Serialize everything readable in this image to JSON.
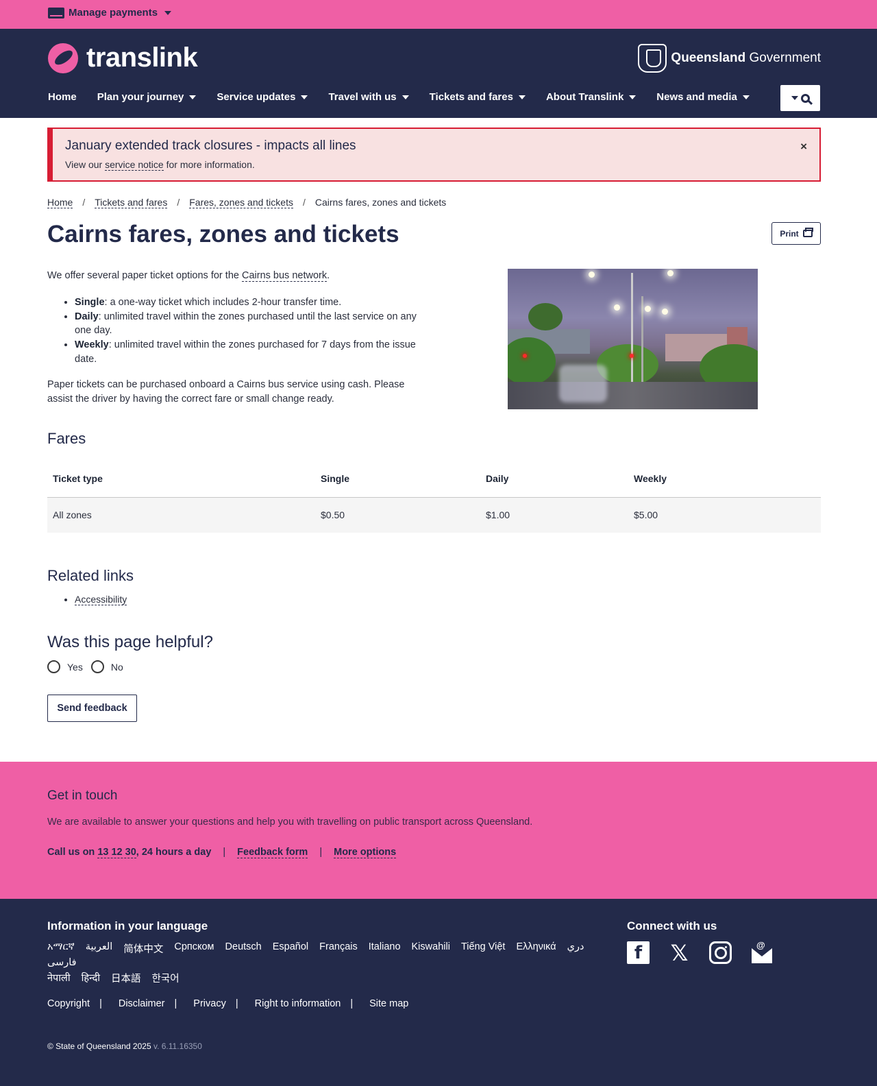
{
  "utility": {
    "manage_payments": "Manage payments"
  },
  "header": {
    "logo_text": "translink",
    "gov_bold": "Queensland",
    "gov_rest": " Government",
    "nav": [
      {
        "label": "Home",
        "dropdown": false
      },
      {
        "label": "Plan your journey",
        "dropdown": true
      },
      {
        "label": "Service updates",
        "dropdown": true
      },
      {
        "label": "Travel with us",
        "dropdown": true
      },
      {
        "label": "Tickets and fares",
        "dropdown": true
      },
      {
        "label": "About Translink",
        "dropdown": true
      },
      {
        "label": "News and media",
        "dropdown": true
      }
    ]
  },
  "alert": {
    "title": "January extended track closures - impacts all lines",
    "body_before": "View our ",
    "body_link": "service notice",
    "body_after": " for more information.",
    "close": "×",
    "accent_color": "#d71d34"
  },
  "breadcrumb": {
    "items": [
      "Home",
      "Tickets and fares",
      "Fares, zones and tickets"
    ],
    "current": "Cairns fares, zones and tickets",
    "sep": "/"
  },
  "page": {
    "title": "Cairns fares, zones and tickets",
    "print_label": "Print",
    "intro_before": "We offer several paper ticket options for the ",
    "intro_link": "Cairns bus network",
    "intro_after": ".",
    "tickets": [
      {
        "name": "Single",
        "desc": ": a one-way ticket which includes 2-hour transfer time."
      },
      {
        "name": "Daily",
        "desc": ": unlimited travel within the zones purchased until the last service on any one day."
      },
      {
        "name": "Weekly",
        "desc": ": unlimited travel within the zones purchased for 7 days from the issue date."
      }
    ],
    "purchase_note": "Paper tickets can be purchased onboard a Cairns bus service using cash. Please assist the driver by having the correct fare or small change ready."
  },
  "fares": {
    "heading": "Fares",
    "headers": [
      "Ticket type",
      "Single",
      "Daily",
      "Weekly"
    ],
    "rows": [
      [
        "All zones",
        "$0.50",
        "$1.00",
        "$5.00"
      ]
    ]
  },
  "related": {
    "heading": "Related links",
    "links": [
      "Accessibility"
    ]
  },
  "feedback": {
    "heading": "Was this page helpful?",
    "yes": "Yes",
    "no": "No",
    "send": "Send feedback"
  },
  "touch": {
    "heading": "Get in touch",
    "text": "We are available to answer your questions and help you with travelling on public transport across Queensland.",
    "call_before": "Call us on ",
    "call_number": "13 12 30",
    "call_after": ", 24 hours a day",
    "feedback_form": "Feedback form",
    "more_options": "More options",
    "sep": "|"
  },
  "footer": {
    "lang_heading": "Information in your language",
    "languages": [
      "አማርኛ",
      "العربية",
      "简体中文",
      "Српском",
      "Deutsch",
      "Español",
      "Français",
      "Italiano",
      "Kiswahili",
      "Tiếng Việt",
      "Ελληνικά",
      "دري",
      "فارسی",
      "नेपाली",
      "हिन्दी",
      "日本語",
      "한국어"
    ],
    "connect_heading": "Connect with us",
    "social": [
      "facebook-icon",
      "x-icon",
      "instagram-icon",
      "email-icon"
    ],
    "legal": [
      "Copyright",
      "Disclaimer",
      "Privacy",
      "Right to information",
      "Site map"
    ],
    "copyright": "© State of Queensland 2025",
    "version": " v. 6.11.16350"
  },
  "colors": {
    "pink": "#ef5fa5",
    "navy": "#232a4a"
  }
}
